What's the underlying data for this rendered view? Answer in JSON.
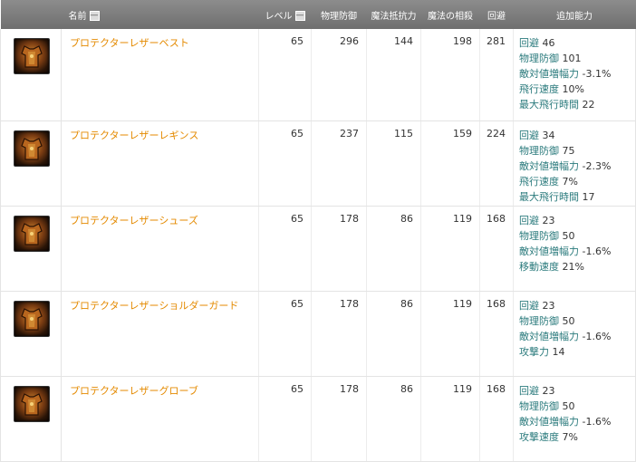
{
  "columns": {
    "name": "名前",
    "level": "レベル",
    "phys_def": "物理防御",
    "magic_resist": "魔法抵抗力",
    "magic_offset": "魔法の相殺",
    "evasion": "回避",
    "bonus": "追加能力",
    "sort_symbol": "—"
  },
  "items": [
    {
      "icon": "leather-vest-icon",
      "name": "プロテクターレザーベスト",
      "level": "65",
      "phys_def": "296",
      "magic_resist": "144",
      "magic_offset": "198",
      "evasion": "281",
      "bonuses": [
        {
          "label": "回避",
          "value": "46"
        },
        {
          "label": "物理防御",
          "value": "101"
        },
        {
          "label": "敵対値増幅力",
          "value": "-3.1%"
        },
        {
          "label": "飛行速度",
          "value": "10%"
        },
        {
          "label": "最大飛行時間",
          "value": "22"
        }
      ]
    },
    {
      "icon": "leather-leggings-icon",
      "name": "プロテクターレザーレギンス",
      "level": "65",
      "phys_def": "237",
      "magic_resist": "115",
      "magic_offset": "159",
      "evasion": "224",
      "bonuses": [
        {
          "label": "回避",
          "value": "34"
        },
        {
          "label": "物理防御",
          "value": "75"
        },
        {
          "label": "敵対値増幅力",
          "value": "-2.3%"
        },
        {
          "label": "飛行速度",
          "value": "7%"
        },
        {
          "label": "最大飛行時間",
          "value": "17"
        }
      ]
    },
    {
      "icon": "leather-shoes-icon",
      "name": "プロテクターレザーシューズ",
      "level": "65",
      "phys_def": "178",
      "magic_resist": "86",
      "magic_offset": "119",
      "evasion": "168",
      "bonuses": [
        {
          "label": "回避",
          "value": "23"
        },
        {
          "label": "物理防御",
          "value": "50"
        },
        {
          "label": "敵対値増幅力",
          "value": "-1.6%"
        },
        {
          "label": "移動速度",
          "value": "21%"
        }
      ]
    },
    {
      "icon": "leather-shoulder-guard-icon",
      "name": "プロテクターレザーショルダーガード",
      "level": "65",
      "phys_def": "178",
      "magic_resist": "86",
      "magic_offset": "119",
      "evasion": "168",
      "bonuses": [
        {
          "label": "回避",
          "value": "23"
        },
        {
          "label": "物理防御",
          "value": "50"
        },
        {
          "label": "敵対値増幅力",
          "value": "-1.6%"
        },
        {
          "label": "攻撃力",
          "value": "14"
        }
      ]
    },
    {
      "icon": "leather-gloves-icon",
      "name": "プロテクターレザーグローブ",
      "level": "65",
      "phys_def": "178",
      "magic_resist": "86",
      "magic_offset": "119",
      "evasion": "168",
      "bonuses": [
        {
          "label": "回避",
          "value": "23"
        },
        {
          "label": "物理防御",
          "value": "50"
        },
        {
          "label": "敵対値増幅力",
          "value": "-1.6%"
        },
        {
          "label": "攻撃速度",
          "value": "7%"
        }
      ]
    }
  ]
}
